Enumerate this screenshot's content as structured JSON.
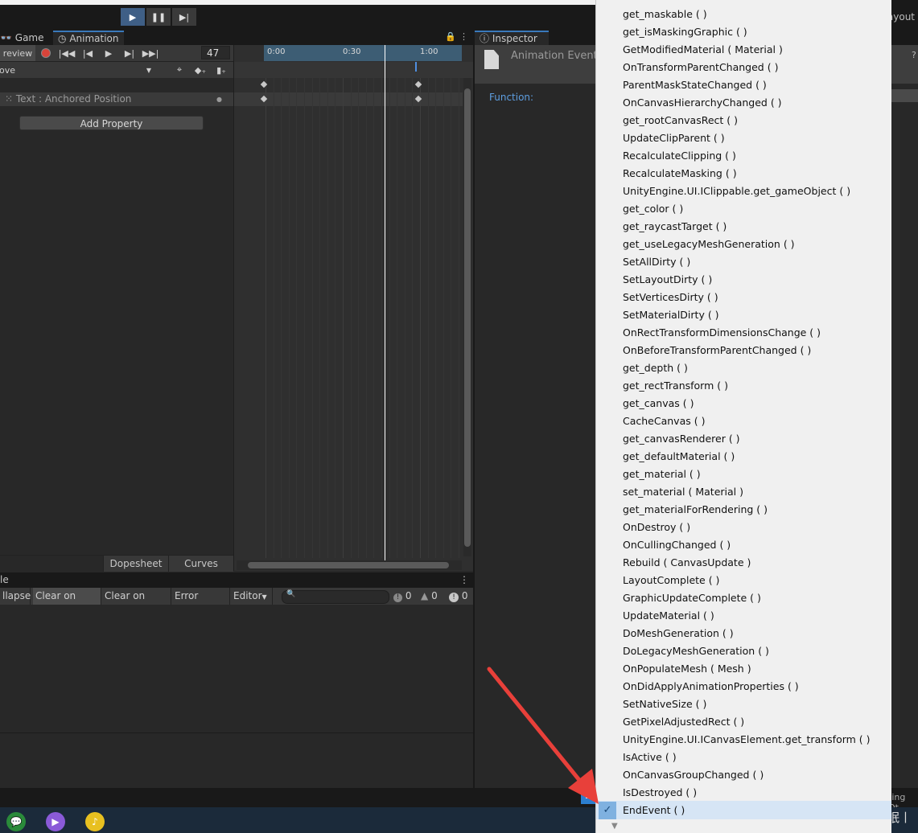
{
  "toolbar": {
    "layout_label": "ayout"
  },
  "tabs": {
    "game": "Game",
    "animation": "Animation",
    "inspector": "Inspector",
    "console_partial": "le"
  },
  "animation": {
    "preview_label": "review",
    "frame_value": "47",
    "clip_name": "love",
    "property": "Text : Anchored Position",
    "add_property": "Add Property",
    "dopesheet": "Dopesheet",
    "curves": "Curves",
    "ruler_labels": [
      "0:00",
      "0:30",
      "1:00"
    ]
  },
  "console": {
    "collapse": "llapse",
    "clear_on_play": "Clear on Play",
    "clear_on_build": "Clear on Build",
    "error_pause": "Error Pause",
    "editor": "Editor",
    "count_log": "0",
    "count_warn": "0",
    "count_error": "0"
  },
  "inspector": {
    "title": "Animation Event",
    "function_label": "Function:"
  },
  "status": {
    "right_text": "ting Ot"
  },
  "menu": {
    "items": [
      "get_maskable ( )",
      "get_isMaskingGraphic ( )",
      "GetModifiedMaterial ( Material )",
      "OnTransformParentChanged ( )",
      "ParentMaskStateChanged ( )",
      "OnCanvasHierarchyChanged ( )",
      "get_rootCanvasRect ( )",
      "UpdateClipParent ( )",
      "RecalculateClipping ( )",
      "RecalculateMasking ( )",
      "UnityEngine.UI.IClippable.get_gameObject ( )",
      "get_color ( )",
      "get_raycastTarget ( )",
      "get_useLegacyMeshGeneration ( )",
      "SetAllDirty ( )",
      "SetLayoutDirty ( )",
      "SetVerticesDirty ( )",
      "SetMaterialDirty ( )",
      "OnRectTransformDimensionsChange ( )",
      "OnBeforeTransformParentChanged ( )",
      "get_depth ( )",
      "get_rectTransform ( )",
      "get_canvas ( )",
      "CacheCanvas ( )",
      "get_canvasRenderer ( )",
      "get_defaultMaterial ( )",
      "get_material ( )",
      "set_material ( Material )",
      "get_materialForRendering ( )",
      "OnDestroy ( )",
      "OnCullingChanged ( )",
      "Rebuild ( CanvasUpdate )",
      "LayoutComplete ( )",
      "GraphicUpdateComplete ( )",
      "UpdateMaterial ( )",
      "DoMeshGeneration ( )",
      "DoLegacyMeshGeneration ( )",
      "OnPopulateMesh ( Mesh )",
      "OnDidApplyAnimationProperties ( )",
      "SetNativeSize ( )",
      "GetPixelAdjustedRect ( )",
      "UnityEngine.UI.ICanvasElement.get_transform ( )",
      "IsActive ( )",
      "OnCanvasGroupChanged ( )",
      "IsDestroyed ( )",
      "EndEvent ( )"
    ],
    "selected": "EndEvent ( )"
  },
  "watermark": "CSDN @听雨眠丨",
  "colors": {
    "accent": "#3a79bb",
    "arrow": "#e8403a",
    "menu_bg": "#f0f0f0"
  }
}
